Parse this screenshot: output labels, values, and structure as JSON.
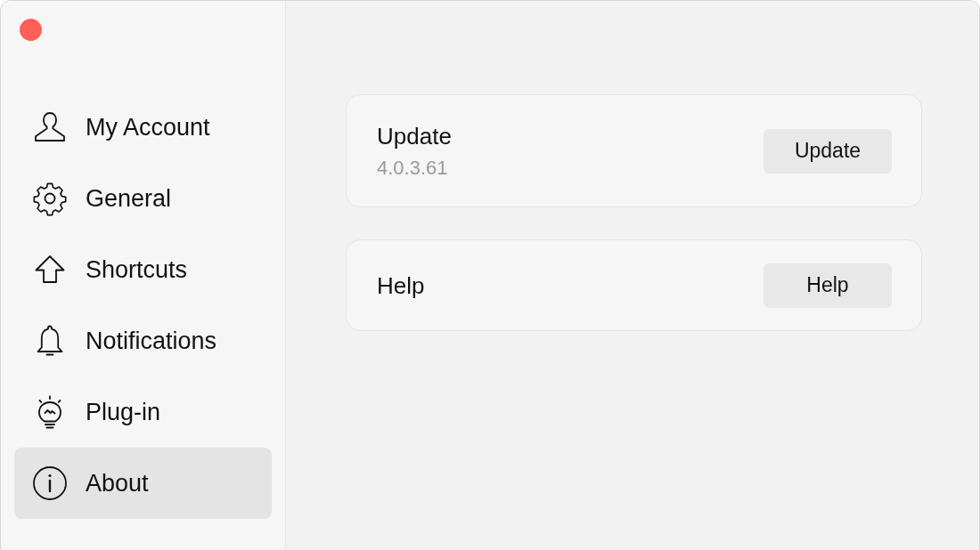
{
  "sidebar": {
    "items": [
      {
        "label": "My Account",
        "selected": false
      },
      {
        "label": "General",
        "selected": false
      },
      {
        "label": "Shortcuts",
        "selected": false
      },
      {
        "label": "Notifications",
        "selected": false
      },
      {
        "label": "Plug-in",
        "selected": false
      },
      {
        "label": "About",
        "selected": true
      }
    ]
  },
  "content": {
    "cards": [
      {
        "title": "Update",
        "subtitle": "4.0.3.61",
        "button": "Update"
      },
      {
        "title": "Help",
        "button": "Help"
      }
    ]
  }
}
